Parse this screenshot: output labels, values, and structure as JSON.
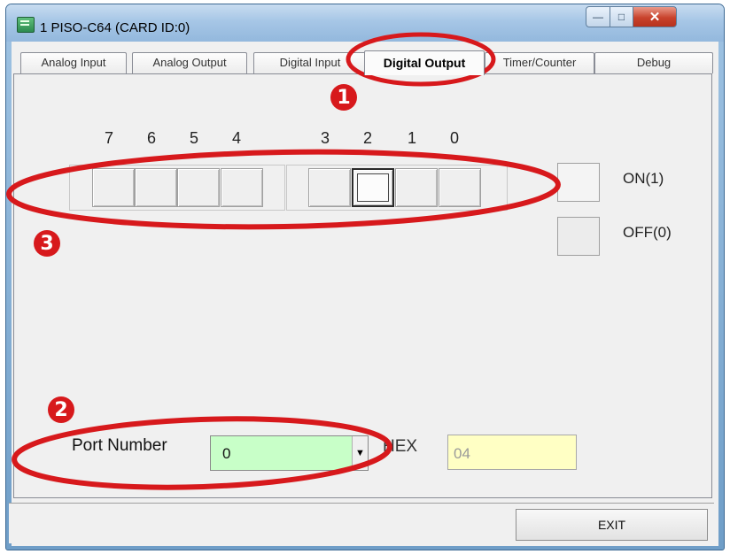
{
  "window": {
    "title": "1 PISO-C64 (CARD ID:0)",
    "buttons": {
      "minimize": "—",
      "maximize": "□",
      "close": "✕"
    }
  },
  "tabs": [
    {
      "label": "Analog Input",
      "active": false
    },
    {
      "label": "Analog Output",
      "active": false
    },
    {
      "label": "Digital Input",
      "active": false
    },
    {
      "label": "Digital Output",
      "active": true
    },
    {
      "label": "Timer/Counter",
      "active": false
    },
    {
      "label": "Debug",
      "active": false
    }
  ],
  "digital_output": {
    "bit_labels": [
      "7",
      "6",
      "5",
      "4",
      "3",
      "2",
      "1",
      "0"
    ],
    "bit_states": [
      0,
      0,
      0,
      0,
      0,
      1,
      0,
      0
    ],
    "legend": {
      "on_label": "ON(1)",
      "off_label": "OFF(0)"
    }
  },
  "port": {
    "label": "Port Number",
    "value": "0",
    "hex_label": "HEX",
    "hex_value": "04"
  },
  "exit_button": "EXIT",
  "annotations": [
    "1",
    "2",
    "3"
  ],
  "colors": {
    "annotation_red": "#d7191c",
    "combo_bg": "#c8ffc8",
    "hex_bg": "#ffffc4"
  }
}
